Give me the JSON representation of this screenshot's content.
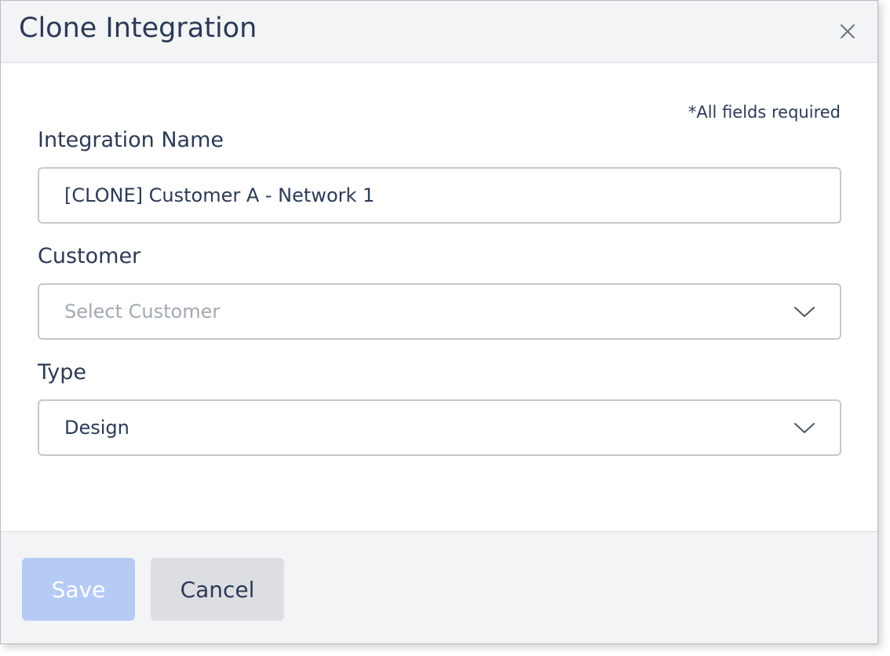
{
  "modal": {
    "title": "Clone Integration",
    "close_icon": "close-icon"
  },
  "form": {
    "required_note": "*All fields required",
    "integration_name": {
      "label": "Integration Name",
      "value": "[CLONE] Customer A - Network 1"
    },
    "customer": {
      "label": "Customer",
      "placeholder": "Select Customer",
      "selected": ""
    },
    "type": {
      "label": "Type",
      "selected": "Design"
    }
  },
  "footer": {
    "save_label": "Save",
    "cancel_label": "Cancel"
  },
  "colors": {
    "text": "#2c3a55",
    "header_bg": "#f3f4f6",
    "save_disabled_bg": "#b5caf5",
    "cancel_bg": "#dcdee2",
    "placeholder": "#a3a9b3",
    "border": "#c4c7cc"
  }
}
